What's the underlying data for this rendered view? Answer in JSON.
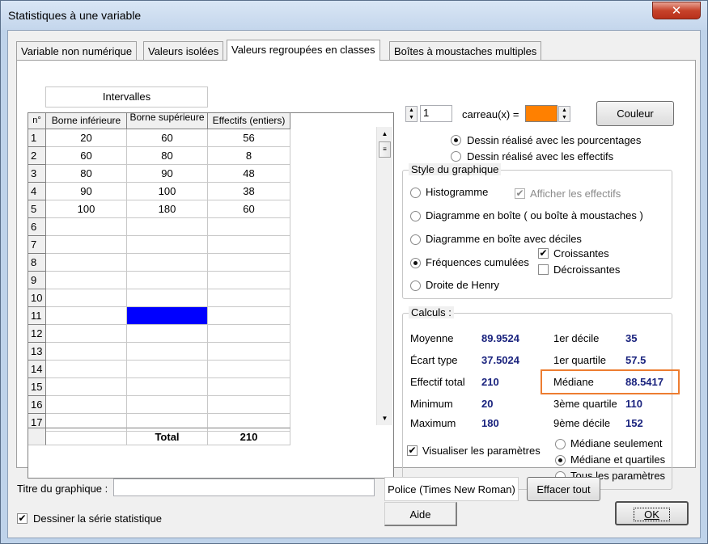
{
  "window": {
    "title": "Statistiques à une variable"
  },
  "tabs": [
    "Variable non numérique",
    "Valeurs isolées",
    "Valeurs regroupées en classes",
    "Boîtes à moustaches multiples"
  ],
  "table": {
    "group_header": "Intervalles",
    "col_index": "n°",
    "col_lower": "Borne inférieure",
    "col_upper": "Borne supérieure",
    "col_count": "Effectifs (entiers)",
    "rows": [
      {
        "n": "1",
        "lower": "20",
        "upper": "60",
        "count": "56"
      },
      {
        "n": "2",
        "lower": "60",
        "upper": "80",
        "count": "8"
      },
      {
        "n": "3",
        "lower": "80",
        "upper": "90",
        "count": "48"
      },
      {
        "n": "4",
        "lower": "90",
        "upper": "100",
        "count": "38"
      },
      {
        "n": "5",
        "lower": "100",
        "upper": "180",
        "count": "60"
      },
      {
        "n": "6",
        "lower": "",
        "upper": "",
        "count": ""
      },
      {
        "n": "7",
        "lower": "",
        "upper": "",
        "count": ""
      },
      {
        "n": "8",
        "lower": "",
        "upper": "",
        "count": ""
      },
      {
        "n": "9",
        "lower": "",
        "upper": "",
        "count": ""
      },
      {
        "n": "10",
        "lower": "",
        "upper": "",
        "count": ""
      },
      {
        "n": "11",
        "lower": "",
        "upper": "",
        "count": ""
      },
      {
        "n": "12",
        "lower": "",
        "upper": "",
        "count": ""
      },
      {
        "n": "13",
        "lower": "",
        "upper": "",
        "count": ""
      },
      {
        "n": "14",
        "lower": "",
        "upper": "",
        "count": ""
      },
      {
        "n": "15",
        "lower": "",
        "upper": "",
        "count": ""
      },
      {
        "n": "16",
        "lower": "",
        "upper": "",
        "count": ""
      },
      {
        "n": "17",
        "lower": "",
        "upper": "",
        "count": ""
      }
    ],
    "selected_cell_color": "#0000ff",
    "total_label": "Total",
    "total_value": "210"
  },
  "squares": {
    "value": "1",
    "label": "carreau(x) =",
    "color": "#ff8000",
    "color_button": "Couleur"
  },
  "drawing_mode": {
    "percent": "Dessin réalisé avec les pourcentages",
    "counts": "Dessin réalisé avec les effectifs",
    "selected": "percent"
  },
  "style": {
    "title": "Style du graphique",
    "histogram": "Histogramme",
    "show_counts": "Afficher les effectifs",
    "box": "Diagramme en boîte ( ou boîte à moustaches )",
    "box_deciles": "Diagramme en boîte avec déciles",
    "cumulative": "Fréquences cumulées",
    "increasing": "Croissantes",
    "decreasing": "Décroissantes",
    "henry": "Droite de Henry",
    "selected": "cumulative"
  },
  "calc": {
    "title": "Calculs :",
    "mean_label": "Moyenne",
    "mean": "89.9524",
    "sd_label": "Écart type",
    "sd": "37.5024",
    "total_label": "Effectif total",
    "total": "210",
    "min_label": "Minimum",
    "min": "20",
    "max_label": "Maximum",
    "max": "180",
    "d1_label": "1er décile",
    "d1": "35",
    "q1_label": "1er quartile",
    "q1": "57.5",
    "median_label": "Médiane",
    "median": "88.5417",
    "q3_label": "3ème quartile",
    "q3": "110",
    "d9_label": "9ème décile",
    "d9": "152",
    "highlight_color": "#ed7d31",
    "show_params": "Visualiser les paramètres",
    "median_only": "Médiane seulement",
    "median_quartiles": "Médiane et quartiles",
    "all_params": "Tous les paramètres",
    "params_selected": "median_quartiles"
  },
  "footer": {
    "chart_title_label": "Titre du graphique :",
    "chart_title_value": "",
    "font_button": "Police (Times New Roman)",
    "clear_button": "Effacer tout",
    "help_button": "Aide",
    "ok_button": "OK",
    "draw_series": "Dessiner la série statistique"
  }
}
